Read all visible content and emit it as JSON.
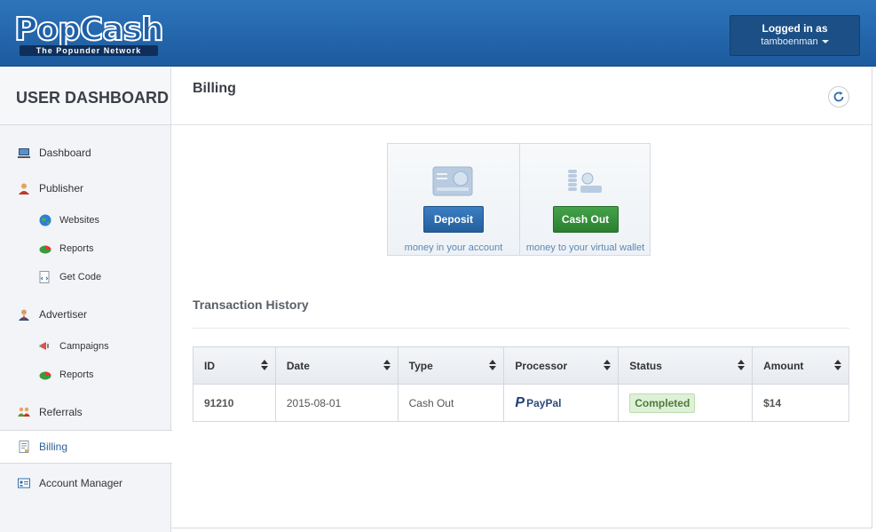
{
  "header": {
    "logo_text": "PopCash",
    "logo_tagline": "The Popunder Network",
    "login_title": "Logged in as",
    "username": "tamboenman"
  },
  "sidebar": {
    "title": "USER DASHBOARD",
    "items": [
      {
        "label": "Dashboard",
        "icon": "monitor-icon"
      },
      {
        "label": "Publisher",
        "icon": "user-icon"
      },
      {
        "label": "Websites",
        "icon": "globe-icon"
      },
      {
        "label": "Reports",
        "icon": "pie-chart-icon"
      },
      {
        "label": "Get Code",
        "icon": "code-icon"
      },
      {
        "label": "Advertiser",
        "icon": "businessman-icon"
      },
      {
        "label": "Campaigns",
        "icon": "megaphone-icon"
      },
      {
        "label": "Reports",
        "icon": "pie-chart-icon"
      },
      {
        "label": "Referrals",
        "icon": "people-icon"
      },
      {
        "label": "Billing",
        "icon": "bill-icon"
      },
      {
        "label": "Account Manager",
        "icon": "id-card-icon"
      }
    ],
    "active_item": "Billing"
  },
  "page": {
    "title": "Billing"
  },
  "actions": {
    "deposit": {
      "label": "Deposit",
      "caption": "money in your account"
    },
    "cashout": {
      "label": "Cash Out",
      "caption": "money to your virtual wallet"
    }
  },
  "history": {
    "title": "Transaction History",
    "columns": [
      "ID",
      "Date",
      "Type",
      "Processor",
      "Status",
      "Amount"
    ],
    "rows": [
      {
        "id": "91210",
        "date": "2015-08-01",
        "type": "Cash Out",
        "processor": "PayPal",
        "status": "Completed",
        "amount": "$14"
      }
    ]
  },
  "colors": {
    "header_blue": "#2d75bb",
    "deposit_blue": "#2f6fae",
    "cashout_green": "#399340",
    "status_green_bg": "#dff0d8"
  }
}
